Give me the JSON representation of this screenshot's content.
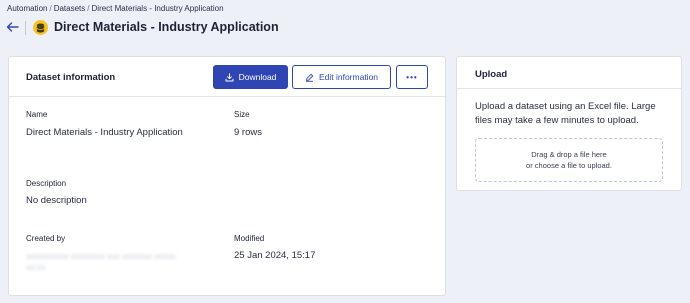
{
  "breadcrumb": [
    "Automation",
    "Datasets",
    "Direct Materials - Industry Application"
  ],
  "breadcrumb_separator": "/",
  "page": {
    "title": "Direct Materials - Industry Application",
    "icon": "database-icon",
    "accent_color": "#2f45b4",
    "icon_color": "#f4c326"
  },
  "info_card": {
    "title": "Dataset information",
    "buttons": {
      "download": "Download",
      "edit": "Edit information",
      "more": "•••"
    },
    "fields": {
      "name_label": "Name",
      "name_value": "Direct Materials - Industry Application",
      "size_label": "Size",
      "size_value": "9 rows",
      "description_label": "Description",
      "description_value": "No description",
      "created_by_label": "Created by",
      "created_by_value": "",
      "modified_label": "Modified",
      "modified_value": "25 Jan 2024, 15:17"
    }
  },
  "upload_card": {
    "title": "Upload",
    "description": "Upload a dataset using an Excel file. Large files may take a few minutes to upload.",
    "dropzone_line1": "Drag & drop a file here",
    "dropzone_line2": "or choose a file to upload."
  }
}
